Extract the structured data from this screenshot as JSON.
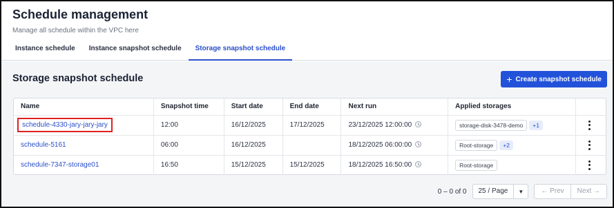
{
  "header": {
    "title": "Schedule management",
    "subtitle": "Manage all schedule within the VPC here"
  },
  "tabs": [
    {
      "label": "Instance schedule",
      "active": false
    },
    {
      "label": "Instance snapshot schedule",
      "active": false
    },
    {
      "label": "Storage snapshot schedule",
      "active": true
    }
  ],
  "section": {
    "title": "Storage snapshot schedule",
    "create_label": "Create snapshot schedule",
    "create_icon": "plus-icon"
  },
  "table": {
    "columns": [
      "Name",
      "Snapshot time",
      "Start date",
      "End date",
      "Next run",
      "Applied storages"
    ],
    "rows": [
      {
        "name": "schedule-4330-jary-jary-jary",
        "snapshot_time": "12:00",
        "start_date": "16/12/2025",
        "end_date": "17/12/2025",
        "next_run": "23/12/2025 12:00:00",
        "storage": "storage-disk-3478-demo",
        "more": "+1"
      },
      {
        "name": "schedule-5161",
        "snapshot_time": "06:00",
        "start_date": "16/12/2025",
        "end_date": "",
        "next_run": "18/12/2025 06:00:00",
        "storage": "Root-storage",
        "more": "+2"
      },
      {
        "name": "schedule-7347-storage01",
        "snapshot_time": "16:50",
        "start_date": "15/12/2025",
        "end_date": "15/12/2025",
        "next_run": "18/12/2025 16:50:00",
        "storage": "Root-storage",
        "more": ""
      }
    ]
  },
  "pagination": {
    "range": "0 – 0 of 0",
    "page_size": "25 / Page",
    "prev": "← Prev",
    "next": "Next →"
  },
  "colors": {
    "accent": "#2152d9",
    "link": "#2a4fc9",
    "highlight": "#e02020"
  }
}
